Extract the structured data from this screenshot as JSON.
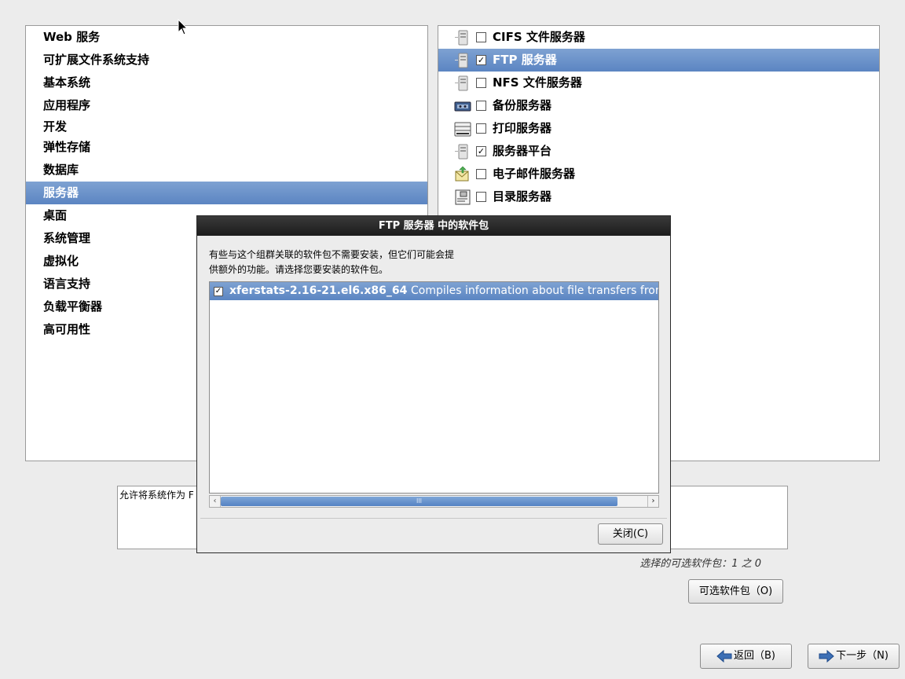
{
  "categories": {
    "items": [
      {
        "label": "Web 服务"
      },
      {
        "label": "可扩展文件系统支持"
      },
      {
        "label": "基本系统"
      },
      {
        "label": "应用程序"
      },
      {
        "label": "开发"
      },
      {
        "label": "弹性存储"
      },
      {
        "label": "数据库"
      },
      {
        "label": "服务器",
        "selected": true
      },
      {
        "label": "桌面"
      },
      {
        "label": "系统管理"
      },
      {
        "label": "虚拟化"
      },
      {
        "label": "语言支持"
      },
      {
        "label": "负载平衡器"
      },
      {
        "label": "高可用性"
      }
    ]
  },
  "options": {
    "items": [
      {
        "label": "CIFS 文件服务器",
        "checked": false,
        "icon": "server-tower-icon"
      },
      {
        "label": "FTP 服务器",
        "checked": true,
        "selected": true,
        "icon": "server-tower-icon"
      },
      {
        "label": "NFS 文件服务器",
        "checked": false,
        "icon": "server-tower-icon"
      },
      {
        "label": "备份服务器",
        "checked": false,
        "icon": "tape-drive-icon"
      },
      {
        "label": "打印服务器",
        "checked": false,
        "icon": "printer-icon"
      },
      {
        "label": "服务器平台",
        "checked": true,
        "icon": "server-tower-icon"
      },
      {
        "label": "电子邮件服务器",
        "checked": false,
        "icon": "mail-icon"
      },
      {
        "label": "目录服务器",
        "checked": false,
        "icon": "directory-icon"
      }
    ]
  },
  "description": {
    "text": "允许将系统作为 F"
  },
  "selection_count": {
    "text": "选择的可选软件包：1 之 0"
  },
  "buttons": {
    "optional_label": "可选软件包（O)",
    "back_label": "返回（B)",
    "next_label": "下一步（N)"
  },
  "dialog": {
    "title": "FTP 服务器 中的软件包",
    "desc_line1": "有些与这个组群关联的软件包不需要安装，但它们可能会提",
    "desc_line2": "供额外的功能。请选择您要安装的软件包。",
    "package": {
      "name": "xferstats-2.16-21.el6.x86_64",
      "separator": "-",
      "description": "Compiles information about file transfers from logfiles",
      "checked": true
    },
    "scroll_grip": "III",
    "close_label": "关闭(C)"
  },
  "colors": {
    "selection": "#5b85c2",
    "dialog_title_bg": "#1c1c1c",
    "window_bg": "#ececec"
  }
}
